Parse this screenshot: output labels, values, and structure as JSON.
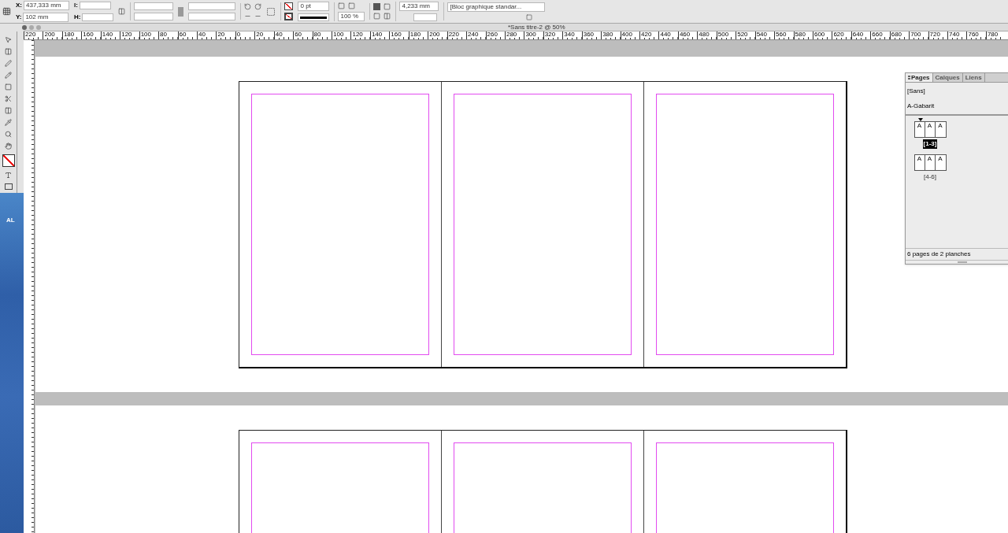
{
  "control_bar": {
    "x_label": "X:",
    "x_value": "437,333 mm",
    "y_label": "Y:",
    "y_value": "102 mm",
    "w_label": "l:",
    "h_label": "H:",
    "stroke_weight": "0 pt",
    "opacity": "100 %",
    "corner_size": "4,233 mm",
    "object_style": "[Bloc graphique standar..."
  },
  "desktop_label": "AL",
  "document": {
    "title": "*Sans titre-2 @ 50%",
    "ruler_labels": [
      "220",
      "200",
      "180",
      "160",
      "140",
      "120",
      "100",
      "80",
      "60",
      "40",
      "20",
      "0",
      "20",
      "40",
      "60",
      "80",
      "100",
      "120",
      "140",
      "160",
      "180",
      "200",
      "220",
      "240",
      "260",
      "280",
      "300",
      "320",
      "340",
      "360",
      "380",
      "400",
      "420",
      "440",
      "460",
      "480",
      "500",
      "520",
      "540",
      "560",
      "580",
      "600",
      "620",
      "640",
      "660",
      "680",
      "700",
      "720",
      "740",
      "760",
      "780"
    ]
  },
  "spreads": [
    {
      "pages": [
        {
          "kind": "page"
        },
        {
          "kind": "page"
        },
        {
          "kind": "page"
        }
      ]
    },
    {
      "pages": [
        {
          "kind": "page"
        },
        {
          "kind": "page"
        },
        {
          "kind": "page"
        }
      ]
    }
  ],
  "pages_panel": {
    "tabs": [
      {
        "label": "Pages",
        "selected": true
      },
      {
        "label": "Calques",
        "selected": false
      },
      {
        "label": "Liens",
        "selected": false
      }
    ],
    "none_master": "[Sans]",
    "master": "A-Gabarit",
    "spreads": [
      {
        "masters": [
          "A",
          "A",
          "A"
        ],
        "label": "[1-3]",
        "selected": true
      },
      {
        "masters": [
          "A",
          "A",
          "A"
        ],
        "label": "[4-6]",
        "selected": false
      }
    ],
    "status": "6 pages de 2 planches"
  }
}
